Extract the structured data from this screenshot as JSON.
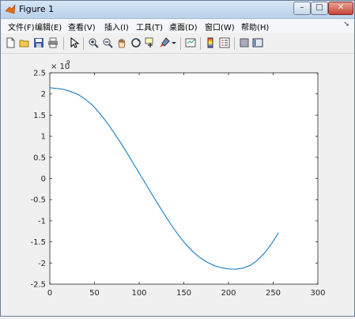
{
  "window": {
    "title": "Figure 1",
    "min": "–",
    "max": "□",
    "close": "✕"
  },
  "menu": {
    "items": [
      "文件(F)",
      "编辑(E)",
      "查看(V)",
      "插入(I)",
      "工具(T)",
      "桌面(D)",
      "窗口(W)",
      "帮助(H)"
    ],
    "overflow": "➘"
  },
  "toolbar": {
    "icons": [
      "new-figure-icon",
      "open-file-icon",
      "save-icon",
      "print-icon",
      "edit-plot-arrow-icon",
      "zoom-in-icon",
      "zoom-out-icon",
      "pan-hand-icon",
      "rotate-3d-icon",
      "data-cursor-icon",
      "brush-icon",
      "brush-dropdown-icon",
      "link-plot-icon",
      "insert-colorbar-icon",
      "insert-legend-icon",
      "hide-plot-tools-icon",
      "show-plot-tools-icon"
    ]
  },
  "chart_data": {
    "type": "line",
    "x_function": "n = 0..256",
    "x": [
      0,
      8,
      16,
      24,
      32,
      40,
      48,
      56,
      64,
      72,
      80,
      88,
      96,
      104,
      112,
      120,
      128,
      136,
      144,
      152,
      160,
      168,
      176,
      184,
      192,
      200,
      208,
      216,
      224,
      232,
      240,
      248,
      256
    ],
    "y": [
      2147000000.0,
      2130000000.0,
      2106000000.0,
      2053000000.0,
      1983000000.0,
      1870000000.0,
      1730000000.0,
      1540000000.0,
      1320000000.0,
      1080000000.0,
      820000000.0,
      550000000.0,
      270000000.0,
      -10000000.0,
      -290000000.0,
      -570000000.0,
      -840000000.0,
      -1100000000.0,
      -1340000000.0,
      -1550000000.0,
      -1730000000.0,
      -1870000000.0,
      -1980000000.0,
      -2060000000.0,
      -2110000000.0,
      -2140000000.0,
      -2147000000.0,
      -2120000000.0,
      -2060000000.0,
      -1940000000.0,
      -1770000000.0,
      -1550000000.0,
      -1280000000.0
    ],
    "xlim": [
      0,
      300
    ],
    "ylim": [
      -2500000000.0,
      2500000000.0
    ],
    "xticks": [
      "0",
      "50",
      "100",
      "150",
      "200",
      "250",
      "300"
    ],
    "yticks": [
      "2.5",
      "2",
      "1.5",
      "1",
      "0.5",
      "0",
      "-0.5",
      "-1",
      "-1.5",
      "-2",
      "-2.5"
    ],
    "exponent_label": "× 10",
    "exponent_power": "9",
    "line_color": "#0072bd",
    "grid": false
  }
}
